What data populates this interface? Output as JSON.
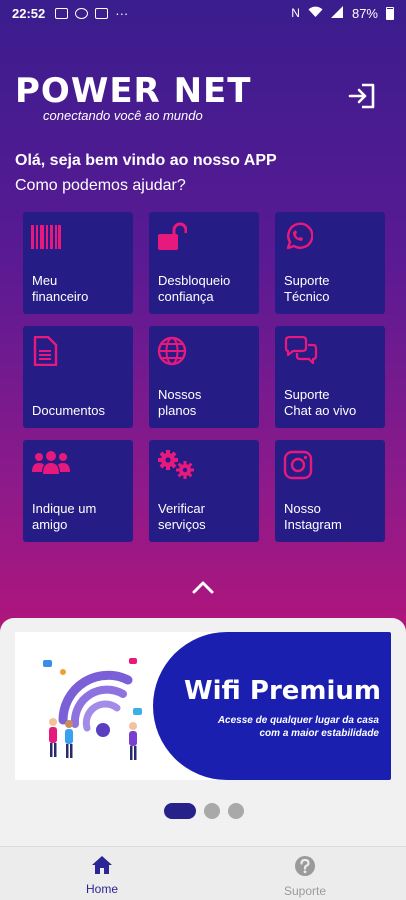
{
  "status_bar": {
    "time": "22:52",
    "more": "···",
    "battery": "87%"
  },
  "brand": {
    "name": "POWER NET",
    "tagline": "conectando você ao mundo"
  },
  "greeting": {
    "title": "Olá, seja bem vindo ao nosso APP",
    "subtitle": "Como podemos ajudar?"
  },
  "tiles": [
    {
      "label": "Meu\nfinanceiro",
      "icon": "barcode-icon"
    },
    {
      "label": "Desbloqueio\nconfiança",
      "icon": "unlock-icon"
    },
    {
      "label": "Suporte\nTécnico",
      "icon": "whatsapp-icon"
    },
    {
      "label": "Documentos",
      "icon": "document-icon"
    },
    {
      "label": "Nossos\nplanos",
      "icon": "globe-icon"
    },
    {
      "label": "Suporte\nChat ao vivo",
      "icon": "chat-icon"
    },
    {
      "label": "Indique um\namigo",
      "icon": "users-icon"
    },
    {
      "label": "Verificar\nserviços",
      "icon": "gears-icon"
    },
    {
      "label": "Nosso\nInstagram",
      "icon": "instagram-icon"
    }
  ],
  "banner": {
    "title": "Wifi Premium",
    "text": "Acesse de qualquer lugar da casa\ncom a maior estabilidade"
  },
  "carousel": {
    "pages": 3,
    "active": 1
  },
  "bottom_nav": {
    "home": "Home",
    "support": "Suporte"
  },
  "colors": {
    "accent": "#e8197c",
    "tile": "#261c86",
    "nav_active": "#2c2695"
  }
}
